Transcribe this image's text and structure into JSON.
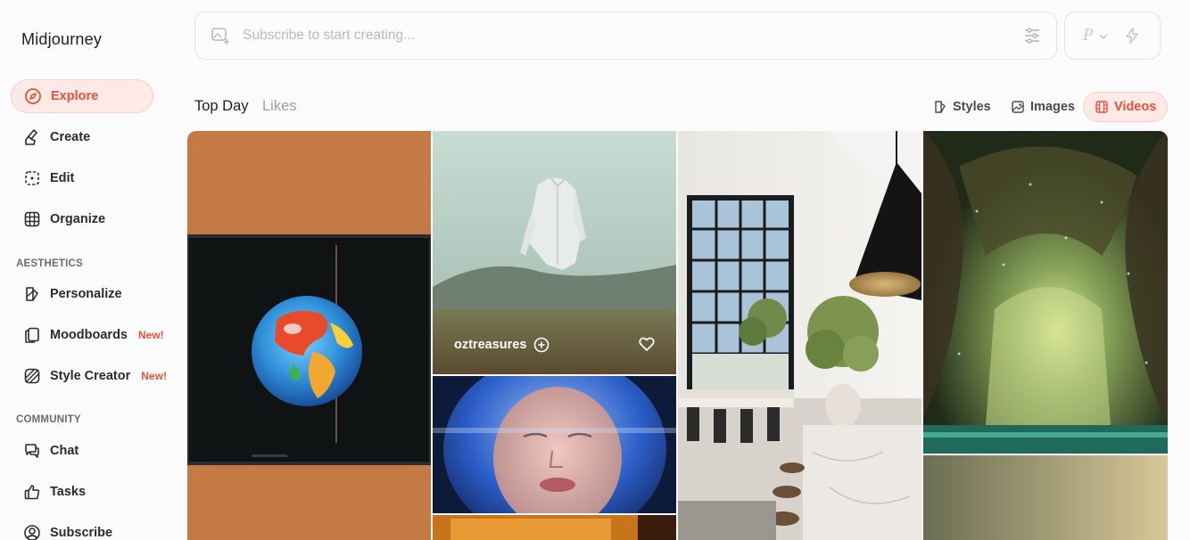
{
  "app": {
    "brand": "Midjourney"
  },
  "sidebar": {
    "primary": [
      {
        "label": "Explore",
        "icon": "compass-icon",
        "active": true
      },
      {
        "label": "Create",
        "icon": "paintbrush-icon"
      },
      {
        "label": "Edit",
        "icon": "edit-icon"
      },
      {
        "label": "Organize",
        "icon": "grid-icon"
      }
    ],
    "aesthetics_label": "AESTHETICS",
    "aesthetics": [
      {
        "label": "Personalize",
        "icon": "personalize-icon"
      },
      {
        "label": "Moodboards",
        "icon": "moodboards-icon",
        "badge": "New!"
      },
      {
        "label": "Style Creator",
        "icon": "style-creator-icon",
        "badge": "New!"
      }
    ],
    "community_label": "COMMUNITY",
    "community": [
      {
        "label": "Chat",
        "icon": "chat-icon"
      },
      {
        "label": "Tasks",
        "icon": "thumbs-up-icon"
      },
      {
        "label": "Subscribe",
        "icon": "user-circle-icon"
      }
    ]
  },
  "prompt": {
    "placeholder": "Subscribe to start creating...",
    "mode_letter": "P"
  },
  "tabs": {
    "top_day": "Top Day",
    "likes": "Likes"
  },
  "filters": {
    "styles": "Styles",
    "images": "Images",
    "videos": "Videos",
    "active": "Videos"
  },
  "gallery": {
    "featured_creator": "oztreasures",
    "tiles": [
      {
        "subject": "earth-on-crt-screen"
      },
      {
        "subject": "floating-shirt-over-field"
      },
      {
        "subject": "face-in-glass-helmet"
      },
      {
        "subject": "bright-interior-with-pendant-lamp"
      },
      {
        "subject": "glowing-forest-tree"
      }
    ]
  },
  "colors": {
    "accent": "#e8503a",
    "accent_bg": "#fde9e5"
  }
}
